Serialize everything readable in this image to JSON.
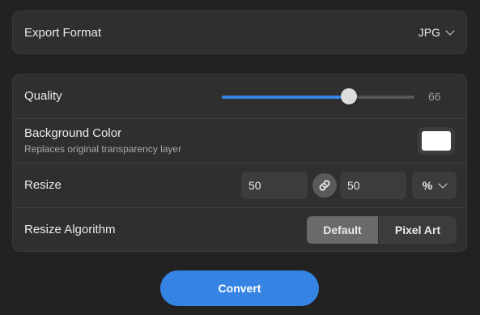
{
  "export_format": {
    "label": "Export Format",
    "selected": "JPG",
    "dropdown_icon": "chevron-down-icon"
  },
  "quality": {
    "label": "Quality",
    "value": "66",
    "min": 0,
    "max": 100,
    "accent_color": "#3584e4"
  },
  "background_color": {
    "label": "Background Color",
    "description": "Replaces original transparency layer",
    "color": "#ffffff"
  },
  "resize": {
    "label": "Resize",
    "width_value": "50",
    "height_value": "50",
    "link_icon": "link-icon",
    "unit": "%",
    "unit_icon": "chevron-down-icon"
  },
  "resize_algorithm": {
    "label": "Resize Algorithm",
    "options": [
      "Default",
      "Pixel Art"
    ],
    "selected": "Default"
  },
  "convert": {
    "label": "Convert",
    "color": "#3584e4"
  }
}
